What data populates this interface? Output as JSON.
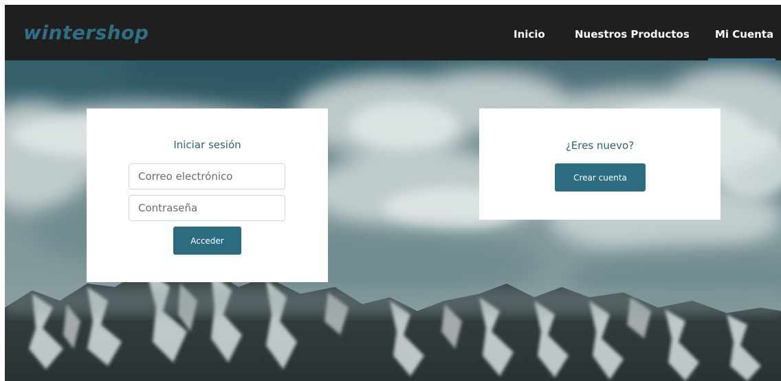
{
  "brand": {
    "logo_text": "wintershop",
    "logo_color": "#2f6f86",
    "accent_color": "#2b6c80"
  },
  "nav": {
    "background": "#1f1f1f",
    "text_color": "#ffffff",
    "items": [
      {
        "label": "Inicio",
        "active": false
      },
      {
        "label": "Nuestros Productos",
        "active": false
      },
      {
        "label": "Mi Cuenta",
        "active": true
      }
    ],
    "active_underline_color": "#3b7f95"
  },
  "login": {
    "title": "Iniciar sesión",
    "email_placeholder": "Correo electrónico",
    "email_value": "",
    "password_placeholder": "Contraseña",
    "password_value": "",
    "submit_label": "Acceder"
  },
  "signup": {
    "title": "¿Eres nuevo?",
    "button_label": "Crear cuenta"
  },
  "background": {
    "subject": "snowy-mountains-under-clouds"
  }
}
